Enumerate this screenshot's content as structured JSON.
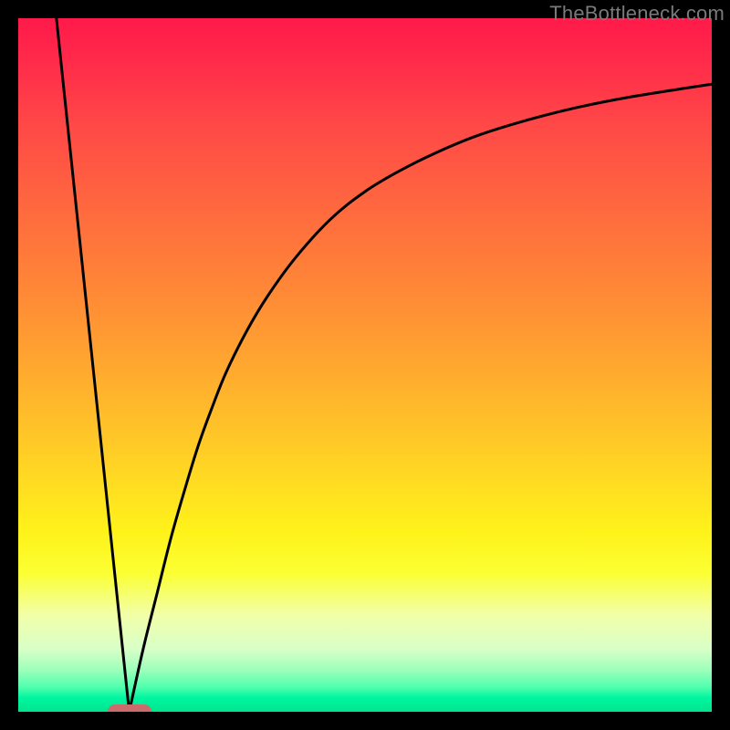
{
  "watermark": "TheBottleneck.com",
  "colors": {
    "frame": "#000000",
    "curve": "#000000",
    "marker": "#cc6b6b"
  },
  "chart_data": {
    "type": "line",
    "title": "",
    "xlabel": "",
    "ylabel": "",
    "xlim": [
      0,
      100
    ],
    "ylim": [
      0,
      100
    ],
    "grid": false,
    "legend": false,
    "annotations": [
      {
        "type": "point-marker",
        "x": 16,
        "y": 0,
        "shape": "pill",
        "color_hex": "#cc6b6b"
      }
    ],
    "series": [
      {
        "name": "left-line",
        "x": [
          5.5,
          16
        ],
        "values": [
          100,
          0
        ]
      },
      {
        "name": "right-curve",
        "x": [
          16,
          18,
          20,
          22,
          24,
          26,
          28,
          30,
          33,
          36,
          40,
          45,
          50,
          55,
          60,
          66,
          73,
          80,
          88,
          100
        ],
        "values": [
          0,
          9,
          17,
          25,
          32,
          38.5,
          44,
          49,
          55,
          60,
          65.5,
          71,
          75,
          78,
          80.5,
          83,
          85.2,
          87,
          88.6,
          90.5
        ]
      }
    ],
    "gradient_stops": [
      {
        "pct": 0,
        "hex": "#ff1a4a"
      },
      {
        "pct": 50,
        "hex": "#ffad2e"
      },
      {
        "pct": 78,
        "hex": "#fff21a"
      },
      {
        "pct": 100,
        "hex": "#00e58e"
      }
    ]
  }
}
